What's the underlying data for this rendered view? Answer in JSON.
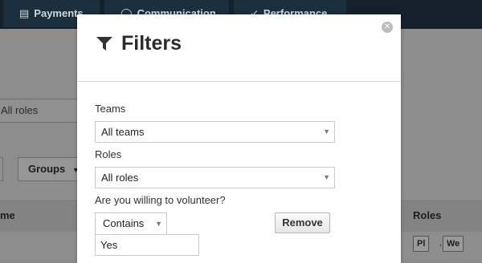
{
  "nav": {
    "tabs": [
      {
        "label": "Payments",
        "icon": "card-icon"
      },
      {
        "label": "Communication",
        "icon": "chat-icon"
      },
      {
        "label": "Performance",
        "icon": "chart-icon"
      }
    ]
  },
  "background": {
    "roles_filter_value": "All roles",
    "groups_button": "Groups",
    "table_headers": {
      "name": "me",
      "roles": "Roles"
    },
    "role_pills": [
      "Pl",
      "We"
    ],
    "pill_separator": ","
  },
  "modal": {
    "title": "Filters",
    "close_symbol": "✕",
    "teams": {
      "label": "Teams",
      "value": "All teams"
    },
    "roles": {
      "label": "Roles",
      "value": "All roles"
    },
    "volunteer": {
      "label": "Are you willing to volunteer?",
      "operator": "Contains",
      "value": "Yes",
      "remove_label": "Remove"
    }
  },
  "colors": {
    "nav_bg": "#14202b",
    "tab_bg": "#1b2f3e",
    "overlay": "#8d8d8d",
    "modal_bg": "#ffffff"
  }
}
